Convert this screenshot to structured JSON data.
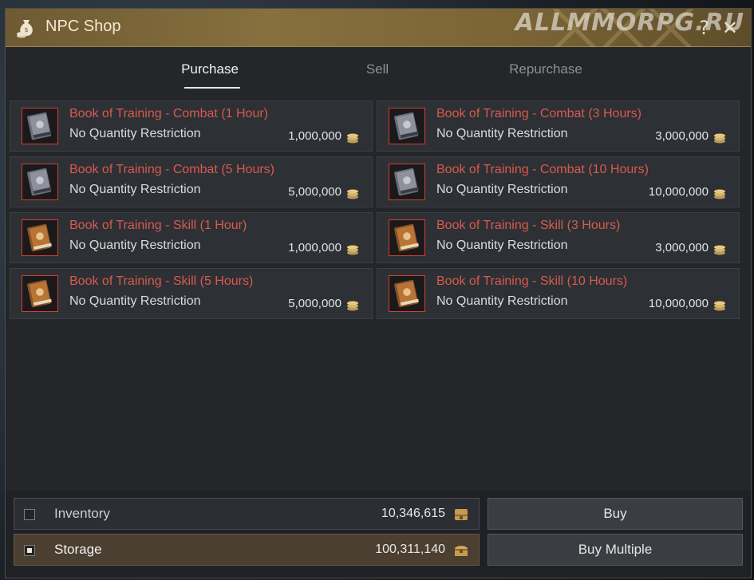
{
  "window": {
    "title": "NPC Shop",
    "help": "?",
    "close": "✕",
    "watermark": "ALLMMORPG.RU"
  },
  "tabs": [
    {
      "label": "Purchase",
      "active": true
    },
    {
      "label": "Sell",
      "active": false
    },
    {
      "label": "Repurchase",
      "active": false
    }
  ],
  "items": [
    {
      "name": "Book of Training - Combat (1 Hour)",
      "limit": "No Quantity Restriction",
      "price": "1,000,000",
      "book": "combat"
    },
    {
      "name": "Book of Training - Combat (3 Hours)",
      "limit": "No Quantity Restriction",
      "price": "3,000,000",
      "book": "combat"
    },
    {
      "name": "Book of Training - Combat (5 Hours)",
      "limit": "No Quantity Restriction",
      "price": "5,000,000",
      "book": "combat"
    },
    {
      "name": "Book of Training - Combat (10 Hours)",
      "limit": "No Quantity Restriction",
      "price": "10,000,000",
      "book": "combat"
    },
    {
      "name": "Book of Training - Skill (1 Hour)",
      "limit": "No Quantity Restriction",
      "price": "1,000,000",
      "book": "skill"
    },
    {
      "name": "Book of Training - Skill (3 Hours)",
      "limit": "No Quantity Restriction",
      "price": "3,000,000",
      "book": "skill"
    },
    {
      "name": "Book of Training - Skill (5 Hours)",
      "limit": "No Quantity Restriction",
      "price": "5,000,000",
      "book": "skill"
    },
    {
      "name": "Book of Training - Skill (10 Hours)",
      "limit": "No Quantity Restriction",
      "price": "10,000,000",
      "book": "skill"
    }
  ],
  "wallets": {
    "inventory": {
      "label": "Inventory",
      "amount": "10,346,615",
      "selected": false
    },
    "storage": {
      "label": "Storage",
      "amount": "100,311,140",
      "selected": true
    }
  },
  "buttons": {
    "buy": "Buy",
    "buy_multiple": "Buy Multiple"
  },
  "colors": {
    "item_name": "#d85a4d",
    "title_bar": "#86703e",
    "icon_border": "#d2402a"
  },
  "icons": {
    "title": "money-bag-icon",
    "coin": "silver-coin-stack-icon",
    "inventory": "bag-icon",
    "storage": "chest-icon"
  }
}
